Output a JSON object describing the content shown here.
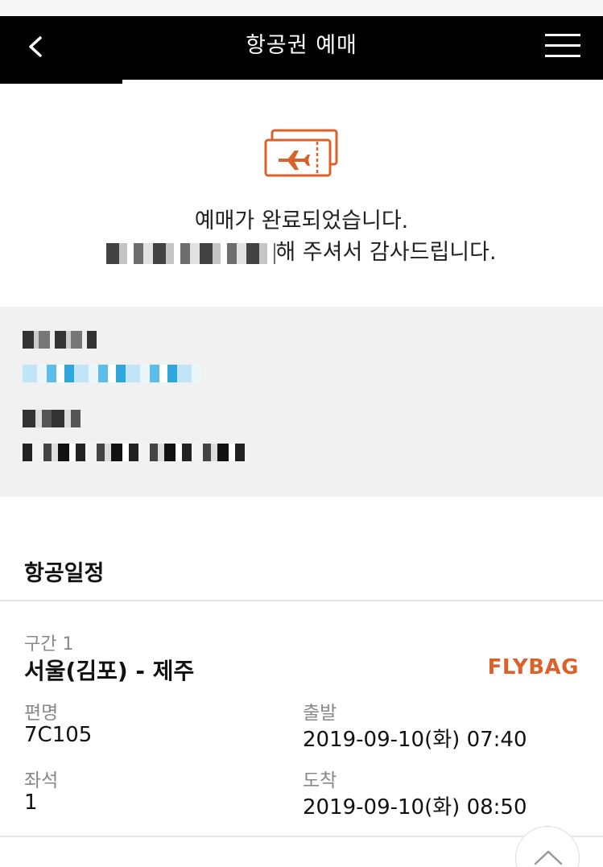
{
  "header": {
    "title": "항공권 예매",
    "back_icon": "chevron-left-icon",
    "menu_icon": "hamburger-menu-icon"
  },
  "confirmation": {
    "icon": "airplane-ticket-icon",
    "line1": "예매가 완료되었습니다.",
    "line2_suffix": "해 주셔서 감사드립니다."
  },
  "itinerary": {
    "section_title": "항공일정",
    "segment_label": "구간 1",
    "route": "서울(김포) - 제주",
    "fare_brand": "FLYBAG",
    "flight_label": "편명",
    "flight_value": "7C105",
    "departure_label": "출발",
    "departure_value": "2019-09-10(화) 07:40",
    "seat_label": "좌석",
    "seat_value": "1",
    "arrival_label": "도착",
    "arrival_value": "2019-09-10(화) 08:50"
  },
  "colors": {
    "accent": "#d9622b",
    "navbar": "#000000",
    "panel": "#f1f1f1"
  }
}
